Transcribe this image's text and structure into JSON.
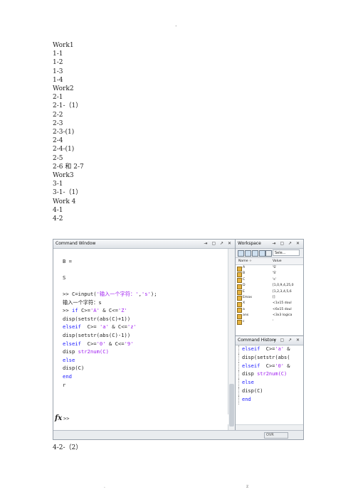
{
  "page": {
    "header_mark": ".",
    "footer_left": ".",
    "footer_right": "z"
  },
  "toc": [
    "Work1",
    "1-1",
    "1-2",
    "1-3",
    "1-4",
    "Work2",
    "2-1",
    "2-1-（1）",
    "2-2",
    "2-3",
    "2-3-(1)",
    "2-4",
    "2-4-(1)",
    "2-5",
    "2-6 和 2-7",
    "Work3",
    "3-1",
    "3-1-（1）",
    "Work 4",
    "4-1",
    "4-2"
  ],
  "caption": "4-2-（2）",
  "command_window": {
    "title": "Command Window",
    "controls": "⇥ ▢ ↗ ✕",
    "lines": [
      {
        "parts": [
          {
            "t": "",
            "c": ""
          }
        ]
      },
      {
        "parts": [
          {
            "t": "B =",
            "c": ""
          }
        ]
      },
      {
        "parts": [
          {
            "t": "",
            "c": ""
          }
        ]
      },
      {
        "parts": [
          {
            "t": "S",
            "c": ""
          }
        ]
      },
      {
        "parts": [
          {
            "t": "",
            "c": ""
          }
        ]
      },
      {
        "parts": [
          {
            "t": ">> C=input(",
            "c": ""
          },
          {
            "t": "'输入一个字符：'",
            "c": "str"
          },
          {
            "t": ",",
            "c": ""
          },
          {
            "t": "'s'",
            "c": "str"
          },
          {
            "t": ");",
            "c": ""
          }
        ]
      },
      {
        "parts": [
          {
            "t": "输入一个字符：s",
            "c": ""
          }
        ]
      },
      {
        "parts": [
          {
            "t": ">> ",
            "c": ""
          },
          {
            "t": "if",
            "c": "kw"
          },
          {
            "t": " C>=",
            "c": ""
          },
          {
            "t": "'A'",
            "c": "str"
          },
          {
            "t": " & C<=",
            "c": ""
          },
          {
            "t": "'Z'",
            "c": "str"
          }
        ]
      },
      {
        "parts": [
          {
            "t": "disp(setstr(abs(C)+1))",
            "c": ""
          }
        ]
      },
      {
        "parts": [
          {
            "t": "elseif",
            "c": "kw"
          },
          {
            "t": "  C>= ",
            "c": ""
          },
          {
            "t": "'a'",
            "c": "str"
          },
          {
            "t": " & C<=",
            "c": ""
          },
          {
            "t": "'z'",
            "c": "str"
          }
        ]
      },
      {
        "parts": [
          {
            "t": "disp(setstr(abs(C)-1))",
            "c": ""
          }
        ]
      },
      {
        "parts": [
          {
            "t": "elseif",
            "c": "kw"
          },
          {
            "t": "  C>=",
            "c": ""
          },
          {
            "t": "'0'",
            "c": "str"
          },
          {
            "t": " & C<=",
            "c": ""
          },
          {
            "t": "'9'",
            "c": "str"
          }
        ]
      },
      {
        "parts": [
          {
            "t": "disp ",
            "c": ""
          },
          {
            "t": "str2num(C)",
            "c": "str"
          }
        ]
      },
      {
        "parts": [
          {
            "t": "else",
            "c": "kw"
          }
        ]
      },
      {
        "parts": [
          {
            "t": "disp(C)",
            "c": ""
          }
        ]
      },
      {
        "parts": [
          {
            "t": "end",
            "c": "kw"
          }
        ]
      },
      {
        "parts": [
          {
            "t": "r",
            "c": ""
          }
        ]
      }
    ],
    "fx": "fx",
    "prompt": ">>"
  },
  "workspace": {
    "title": "Workspace",
    "controls": "⇥ ▢ ↗ ✕",
    "select_label": "Sele...",
    "col_name": "Name ÷",
    "col_value": "Value",
    "rows": [
      {
        "name": "A",
        "value": "'S'"
      },
      {
        "name": "B",
        "value": "'S'"
      },
      {
        "name": "C",
        "value": "'s'"
      },
      {
        "name": "D",
        "value": "[1,0,9,4,25,0"
      },
      {
        "name": "E",
        "value": "[1,2,3,4,5,6"
      },
      {
        "name": "Emax",
        "value": "[]"
      },
      {
        "name": "X",
        "value": "<1x15 doul"
      },
      {
        "name": "a",
        "value": "<6x15 doul"
      },
      {
        "name": "ans",
        "value": "<3x3 logica"
      },
      {
        "name": "c",
        "value": "'"
      }
    ]
  },
  "history": {
    "title": "Command History",
    "controls": "⇥ ▢ ↗ ✕",
    "lines": [
      {
        "parts": [
          {
            "t": "elseif",
            "c": "kw"
          },
          {
            "t": "  C>=",
            "c": ""
          },
          {
            "t": "'a'",
            "c": "str"
          },
          {
            "t": " &",
            "c": ""
          }
        ]
      },
      {
        "parts": [
          {
            "t": "disp(setstr(abs(",
            "c": ""
          }
        ]
      },
      {
        "parts": [
          {
            "t": "elseif",
            "c": "kw"
          },
          {
            "t": "  C>=",
            "c": ""
          },
          {
            "t": "'0'",
            "c": "str"
          },
          {
            "t": " &",
            "c": ""
          }
        ]
      },
      {
        "parts": [
          {
            "t": "disp ",
            "c": ""
          },
          {
            "t": "str2num(C)",
            "c": "str"
          }
        ]
      },
      {
        "parts": [
          {
            "t": "else",
            "c": "kw"
          }
        ]
      },
      {
        "parts": [
          {
            "t": "disp(C)",
            "c": ""
          }
        ]
      },
      {
        "parts": [
          {
            "t": "end",
            "c": "kw"
          }
        ]
      }
    ]
  },
  "status_bar": {
    "mode": "OVR"
  },
  "colors": {
    "keyword": "#2020ff",
    "string": "#a020f0"
  }
}
